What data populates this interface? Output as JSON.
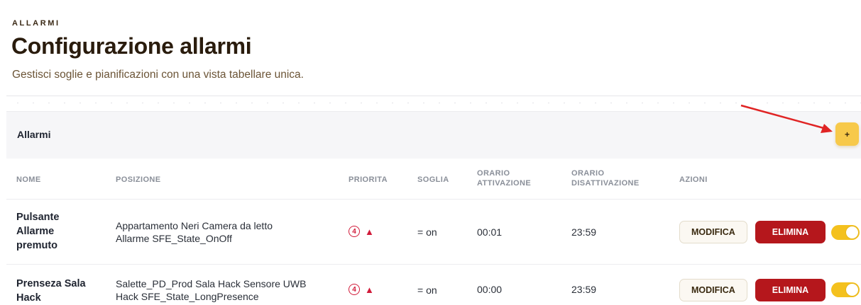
{
  "header": {
    "eyebrow": "ALLARMI",
    "title": "Configurazione allarmi",
    "subtitle": "Gestisci soglie e pianificazioni con una vista tabellare unica."
  },
  "card": {
    "title": "Allarmi",
    "add_label": "+"
  },
  "table": {
    "columns": {
      "nome": "NOME",
      "posizione": "POSIZIONE",
      "priorita": "PRIORITA",
      "soglia": "SOGLIA",
      "orario_attivazione_1": "ORARIO",
      "orario_attivazione_2": "ATTIVAZIONE",
      "orario_disattivazione_1": "ORARIO",
      "orario_disattivazione_2": "DISATTIVAZIONE",
      "azioni": "AZIONI"
    },
    "rows": [
      {
        "name_1": "Pulsante",
        "name_2": "Allarme",
        "name_3": "premuto",
        "position_1": "Appartamento Neri Camera da letto",
        "position_2": "Allarme SFE_State_OnOff",
        "priority": "4",
        "priority_icon": "▲",
        "threshold": "= on",
        "activation": "00:01",
        "deactivation": "23:59",
        "edit_label": "MODIFICA",
        "delete_label": "ELIMINA",
        "enabled": true
      },
      {
        "name_1": "Prenseza Sala",
        "name_2": "Hack",
        "position_1": "Salette_PD_Prod Sala Hack Sensore UWB",
        "position_2": "Hack SFE_State_LongPresence",
        "priority": "4",
        "priority_icon": "▲",
        "threshold": "= on",
        "activation": "00:00",
        "deactivation": "23:59",
        "edit_label": "MODIFICA",
        "delete_label": "ELIMINA",
        "enabled": true
      }
    ]
  },
  "colors": {
    "accent": "#f7c94a",
    "danger": "#b5171c",
    "priority": "#d11b3a",
    "toggle_on": "#f4c11e"
  }
}
